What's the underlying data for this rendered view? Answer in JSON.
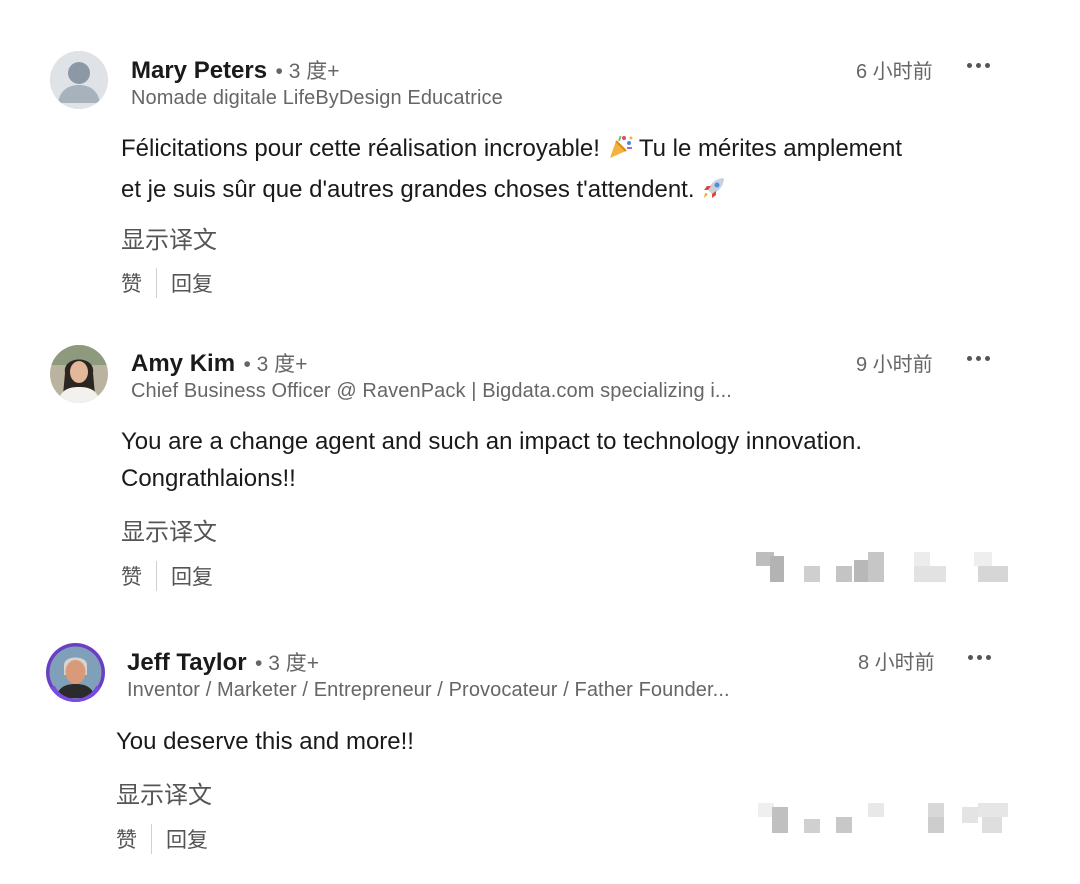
{
  "comments": [
    {
      "name": "Mary Peters",
      "degree": "• 3 度+",
      "headline": "Nomade digitale LifeByDesign Educatrice",
      "time": "6 小时前",
      "body_line1": "Félicitations pour cette réalisation incroyable!",
      "body_line1b": "Tu le mérites amplement",
      "body_line2": "et je suis sûr que d'autres grandes choses t'attendent.",
      "translate": "显示译文",
      "like": "赞",
      "reply": "回复"
    },
    {
      "name": "Amy Kim",
      "degree": "• 3 度+",
      "headline": "Chief Business Officer @ RavenPack | Bigdata.com specializing i...",
      "time": "9 小时前",
      "body_line1": "You are a change agent and such an impact to technology innovation.",
      "body_line2": "Congrathlaions!!",
      "translate": "显示译文",
      "like": "赞",
      "reply": "回复"
    },
    {
      "name": "Jeff Taylor",
      "degree": "• 3 度+",
      "headline": "Inventor / Marketer / Entrepreneur / Provocateur / Father Founder...",
      "time": "8 小时前",
      "body_line1": "You deserve this and more!!",
      "translate": "显示译文",
      "like": "赞",
      "reply": "回复"
    }
  ],
  "icons": {
    "more": "more-options-icon",
    "party": "party-popper-icon",
    "rocket": "rocket-icon"
  }
}
